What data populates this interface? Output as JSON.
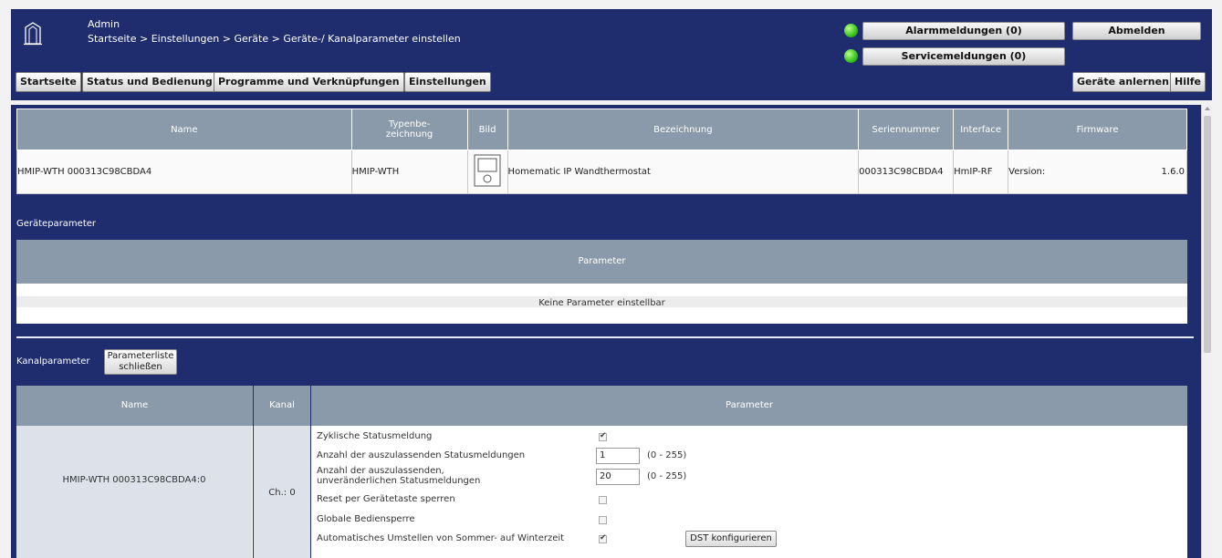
{
  "header": {
    "user": "Admin",
    "breadcrumb": "Startseite > Einstellungen > Geräte > Geräte-/ Kanalparameter einstellen",
    "alarm_btn": "Alarmmeldungen (0)",
    "service_btn": "Servicemeldungen (0)",
    "logout_btn": "Abmelden",
    "status_led_color": "#36c21b"
  },
  "nav": {
    "home": "Startseite",
    "status": "Status und Bedienung",
    "programs": "Programme und Verknüpfungen",
    "settings": "Einstellungen",
    "teach": "Geräte anlernen",
    "help": "Hilfe"
  },
  "device_table": {
    "headers": {
      "name": "Name",
      "type": "Typenbe-zeichnung",
      "image": "Bild",
      "description": "Bezeichnung",
      "serial": "Seriennummer",
      "interface": "Interface",
      "firmware": "Firmware"
    },
    "row": {
      "name": "HMIP-WTH 000313C98CBDA4",
      "type": "HMIP-WTH",
      "description": "Homematic IP Wandthermostat",
      "serial": "000313C98CBDA4",
      "interface": "HmIP-RF",
      "version_label": "Version:",
      "version": "1.6.0"
    }
  },
  "device_params": {
    "section_label": "Geräteparameter",
    "header": "Parameter",
    "empty_text": "Keine Parameter einstellbar"
  },
  "channel_params": {
    "section_label": "Kanalparameter",
    "close_btn_line1": "Parameterliste",
    "close_btn_line2": "schließen",
    "headers": {
      "name": "Name",
      "channel": "Kanal",
      "parameter": "Parameter"
    },
    "row": {
      "name": "HMIP-WTH 000313C98CBDA4:0",
      "channel": "Ch.: 0",
      "params": [
        {
          "label": "Zyklische Statusmeldung",
          "checked": true
        },
        {
          "label": "Anzahl der auszulassenden Statusmeldungen",
          "value": "1",
          "range": "(0 - 255)"
        },
        {
          "label_line1": "Anzahl der auszulassenden,",
          "label_line2": "unveränderlichen Statusmeldungen",
          "value": "20",
          "range": "(0 - 255)"
        },
        {
          "label": "Reset per Gerätetaste sperren",
          "checked": false
        },
        {
          "label": "Globale Bediensperre",
          "checked": false
        },
        {
          "label": "Automatisches Umstellen von Sommer- auf Winterzeit",
          "checked": true,
          "button": "DST konfigurieren"
        }
      ]
    }
  },
  "colors": {
    "navy": "#1f2d6e",
    "table_header": "#8a9aaa",
    "channel_cell": "#dde2ea"
  }
}
